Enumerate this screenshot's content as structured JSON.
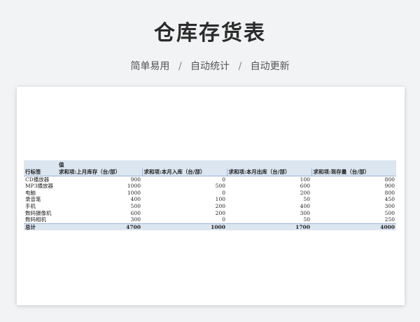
{
  "header": {
    "title": "仓库存货表",
    "subtitle_items": [
      "简单易用",
      "自动统计",
      "自动更新"
    ],
    "subtitle_sep": "/"
  },
  "pivot": {
    "values_label": "值",
    "row_label": "行标签",
    "columns": [
      "求和项:上月库存（台/部）",
      "求和项:本月入库（台/部）",
      "求和项:本月出库（台/部）",
      "求和项:现存量（台/部）"
    ],
    "rows": [
      {
        "label": "CD播放器",
        "values": [
          "900",
          "0",
          "100",
          "800"
        ]
      },
      {
        "label": "MP3播放器",
        "values": [
          "1000",
          "500",
          "600",
          "900"
        ]
      },
      {
        "label": "电脑",
        "values": [
          "1000",
          "0",
          "200",
          "800"
        ]
      },
      {
        "label": "录音笔",
        "values": [
          "400",
          "100",
          "50",
          "450"
        ]
      },
      {
        "label": "手机",
        "values": [
          "500",
          "200",
          "400",
          "300"
        ]
      },
      {
        "label": "数码摄像机",
        "values": [
          "600",
          "200",
          "300",
          "500"
        ]
      },
      {
        "label": "数码相机",
        "values": [
          "300",
          "0",
          "50",
          "250"
        ]
      }
    ],
    "total": {
      "label": "总计",
      "values": [
        "4700",
        "1000",
        "1700",
        "4000"
      ]
    }
  },
  "colors": {
    "header_fill": "#dce6f1",
    "background": "#f2f3f5"
  }
}
